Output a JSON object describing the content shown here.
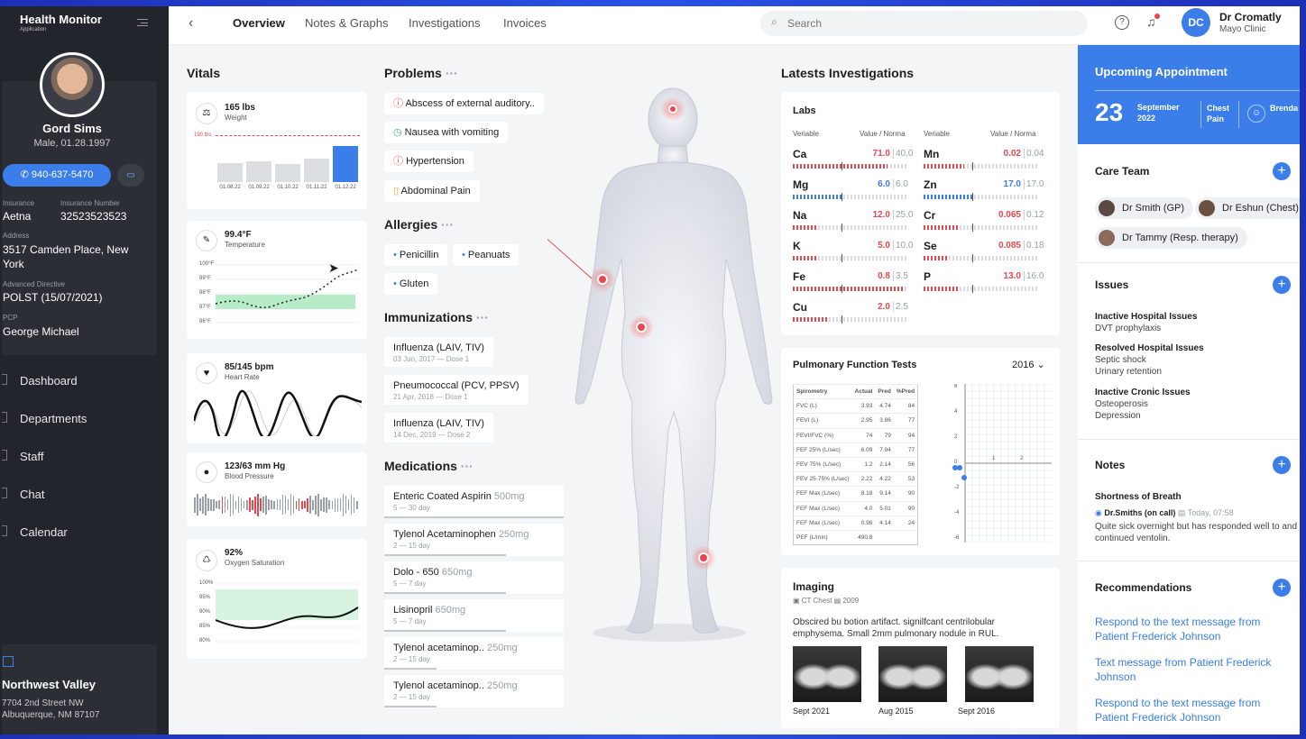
{
  "app": {
    "title": "Health Monitor",
    "subtitle": "Application"
  },
  "patient": {
    "name": "Gord Sims",
    "info": "Male, 01.28.1997",
    "phone": "940-637-5470",
    "insurance_label": "Insurance",
    "insurance": "Aetna",
    "insurance_number_label": "Insurance Number",
    "insurance_number": "32523523523",
    "address_label": "Address",
    "address_line1": "3517 Camden Place, New",
    "address_line2": "York",
    "directive_label": "Advanced Directive",
    "directive": "POLST (15/07/2021)",
    "pcp_label": "PCP",
    "pcp": "George Michael"
  },
  "nav": [
    {
      "label": "Dashboard"
    },
    {
      "label": "Departments"
    },
    {
      "label": "Staff"
    },
    {
      "label": "Chat"
    },
    {
      "label": "Calendar"
    }
  ],
  "clinic": {
    "name": "Northwest Valley",
    "address1": "7704 2nd Street NW",
    "address2": "Albuquerque, NM 87107"
  },
  "tabs": [
    {
      "label": "Overview",
      "active": true
    },
    {
      "label": "Notes & Graphs"
    },
    {
      "label": "Investigations"
    },
    {
      "label": "Invoices"
    }
  ],
  "search": {
    "placeholder": "Search"
  },
  "user": {
    "initials": "DC",
    "name": "Dr Cromatly",
    "org": "Mayo Clinic"
  },
  "vitals": {
    "title": "Vitals",
    "weight": {
      "value": "165 lbs",
      "label": "Weight",
      "ref": "190 lbs",
      "dates": [
        "01.08.22",
        "01.09.22",
        "01.10.22",
        "01.11.22",
        "01.12.22"
      ],
      "values": [
        0.52,
        0.57,
        0.51,
        0.66,
        1.0
      ]
    },
    "temperature": {
      "value": "99.4°F",
      "label": "Temperature",
      "ticks": [
        "100°F",
        "99°F",
        "98°F",
        "97°F",
        "96°F"
      ]
    },
    "heart": {
      "value": "85/145 bpm",
      "label": "Heart Rate"
    },
    "bp": {
      "value": "123/63 mm Hg",
      "label": "Blood Pressure"
    },
    "oxygen": {
      "value": "92%",
      "label": "Oxygen Saturation",
      "ticks": [
        "100%",
        "95%",
        "90%",
        "85%",
        "80%"
      ]
    }
  },
  "problems": {
    "title": "Problems",
    "items": [
      "Abscess of external auditory..",
      "Nausea with vomiting",
      "Hypertension",
      "Abdominal Pain"
    ]
  },
  "allergies": {
    "title": "Allergies",
    "items": [
      "Penicillin",
      "Peanuats",
      "Gluten"
    ]
  },
  "immunizations": {
    "title": "Immunizations",
    "items": [
      {
        "name": "Influenza (LAIV, TIV)",
        "detail": "03 Jun, 2017  —  Dose 1"
      },
      {
        "name": "Pneumococcal (PCV, PPSV)",
        "detail": "21 Apr, 2018  —  Dose 1"
      },
      {
        "name": "Influenza (LAIV, TIV)",
        "detail": "14 Dec, 2019  —  Dose 2"
      }
    ]
  },
  "medications": {
    "title": "Medications",
    "items": [
      {
        "name": "Enteric Coated Aspirin",
        "dose": "500mg",
        "detail": "5 — 30 day"
      },
      {
        "name": "Tylenol Acetaminophen",
        "dose": "250mg",
        "detail": "2 — 15 day"
      },
      {
        "name": "Dolo - 650",
        "dose": "650mg",
        "detail": "5 — 7 day"
      },
      {
        "name": "Lisinopril",
        "dose": "650mg",
        "detail": "5 — 7 day"
      },
      {
        "name": "Tylenol acetaminop..",
        "dose": "250mg",
        "detail": "2 — 15 day"
      },
      {
        "name": "Tylenol acetaminop..",
        "dose": "250mg",
        "detail": "2 — 15 day"
      }
    ]
  },
  "investigations": {
    "title": "Latests Investigations",
    "labs_title": "Labs",
    "col_variable": "Veriable",
    "col_value": "Value / Norma",
    "labs": [
      {
        "name": "Ca",
        "value": "71.0",
        "norm": "40.0",
        "status": "high",
        "fill": 0.82
      },
      {
        "name": "Mn",
        "value": "0.02",
        "norm": "0.04",
        "status": "high",
        "fill": 0.35
      },
      {
        "name": "Mg",
        "value": "6.0",
        "norm": "6.0",
        "status": "normal",
        "fill": 0.42
      },
      {
        "name": "Zn",
        "value": "17.0",
        "norm": "17.0",
        "status": "normal",
        "fill": 0.42
      },
      {
        "name": "Na",
        "value": "12.0",
        "norm": "25.0",
        "status": "high",
        "fill": 0.22
      },
      {
        "name": "Cr",
        "value": "0.065",
        "norm": "0.12",
        "status": "high",
        "fill": 0.3
      },
      {
        "name": "K",
        "value": "5.0",
        "norm": "10.0",
        "status": "high",
        "fill": 0.2
      },
      {
        "name": "Se",
        "value": "0.085",
        "norm": "0.18",
        "status": "high",
        "fill": 0.2
      },
      {
        "name": "Fe",
        "value": "0.8",
        "norm": "3.5",
        "status": "high",
        "fill": 0.95
      },
      {
        "name": "P",
        "value": "13.0",
        "norm": "16.0",
        "status": "high",
        "fill": 0.3
      },
      {
        "name": "Cu",
        "value": "2.0",
        "norm": "2.5",
        "status": "high",
        "fill": 0.3
      }
    ]
  },
  "pft": {
    "title": "Pulmonary Function Tests",
    "year": "2016",
    "headers": [
      "Spirometry",
      "Actual",
      "Pred",
      "%Pred"
    ],
    "rows": [
      [
        "FVC (L)",
        "3.93",
        "4.74",
        "84"
      ],
      [
        "FEVI (L)",
        "2.95",
        "3.86",
        "77"
      ],
      [
        "FEVI/FVC (%)",
        "74",
        "79",
        "94"
      ],
      [
        "FEF 25% (L/sec)",
        "6.09",
        "7.94",
        "77"
      ],
      [
        "FEV 75% (L/sec)",
        "1.2",
        "2.14",
        "56"
      ],
      [
        "FEV 25-75% (L/sec)",
        "2.22",
        "4.22",
        "53"
      ],
      [
        "FEF Max (L/sec)",
        "8.18",
        "9.14",
        "90"
      ],
      [
        "FEF Max (L/sec)",
        "4.0",
        "5.01",
        "90"
      ],
      [
        "FEF Max (L/sec)",
        "0.98",
        "4.14",
        "24"
      ],
      [
        "PEF (L/min)",
        "490.8",
        "",
        ""
      ]
    ],
    "yticks": [
      "6",
      "4",
      "2",
      "0",
      "-2",
      "-4",
      "-6"
    ],
    "xticks": [
      "1",
      "2"
    ]
  },
  "imaging": {
    "title": "Imaging",
    "type": "CT Chest",
    "year": "2009",
    "text": "Obscired bu botion artifact. signilfcant centrilobular emphysema. Small 2mm pulmonary nodule in RUL.",
    "images": [
      "Sept 2021",
      "Aug 2015",
      "Sept 2016"
    ]
  },
  "appointment": {
    "title": "Upcoming Appointment",
    "day": "23",
    "month": "September",
    "year": "2022",
    "type": "Chest Pain",
    "doctor": "Brenda Charle"
  },
  "care_team": {
    "title": "Care Team",
    "members": [
      "Dr Smith (GP)",
      "Dr Eshun (Chest)",
      "Dr Tammy (Resp. therapy)"
    ]
  },
  "issues": {
    "title": "Issues",
    "groups": [
      {
        "label": "Inactive Hospital Issues",
        "items": [
          "DVT prophylaxis"
        ]
      },
      {
        "label": "Resolved Hospital Issues",
        "items": [
          "Septic shock",
          "Urinary retention"
        ]
      },
      {
        "label": "Inactive Cronic Issues",
        "items": [
          "Osteoperosis",
          "Depression"
        ]
      }
    ]
  },
  "notes": {
    "title": "Notes",
    "subject": "Shortness of Breath",
    "author": "Dr.Smiths (on call)",
    "time": "Today, 07:58",
    "text": "Quite sick overnight but has responded well to and continued ventolin."
  },
  "recommendations": {
    "title": "Recommendations",
    "items": [
      "Respond to the text message from Patient Frederick Johnson",
      "Text message from Patient Frederick Johnson",
      "Respond to the text message from Patient Frederick Johnson"
    ]
  },
  "colors": {
    "accent": "#3b7de9",
    "danger": "#e5484d",
    "normal": "#3b7de9",
    "sidebar": "#22252b",
    "chart_green": "#b8ecc8"
  }
}
